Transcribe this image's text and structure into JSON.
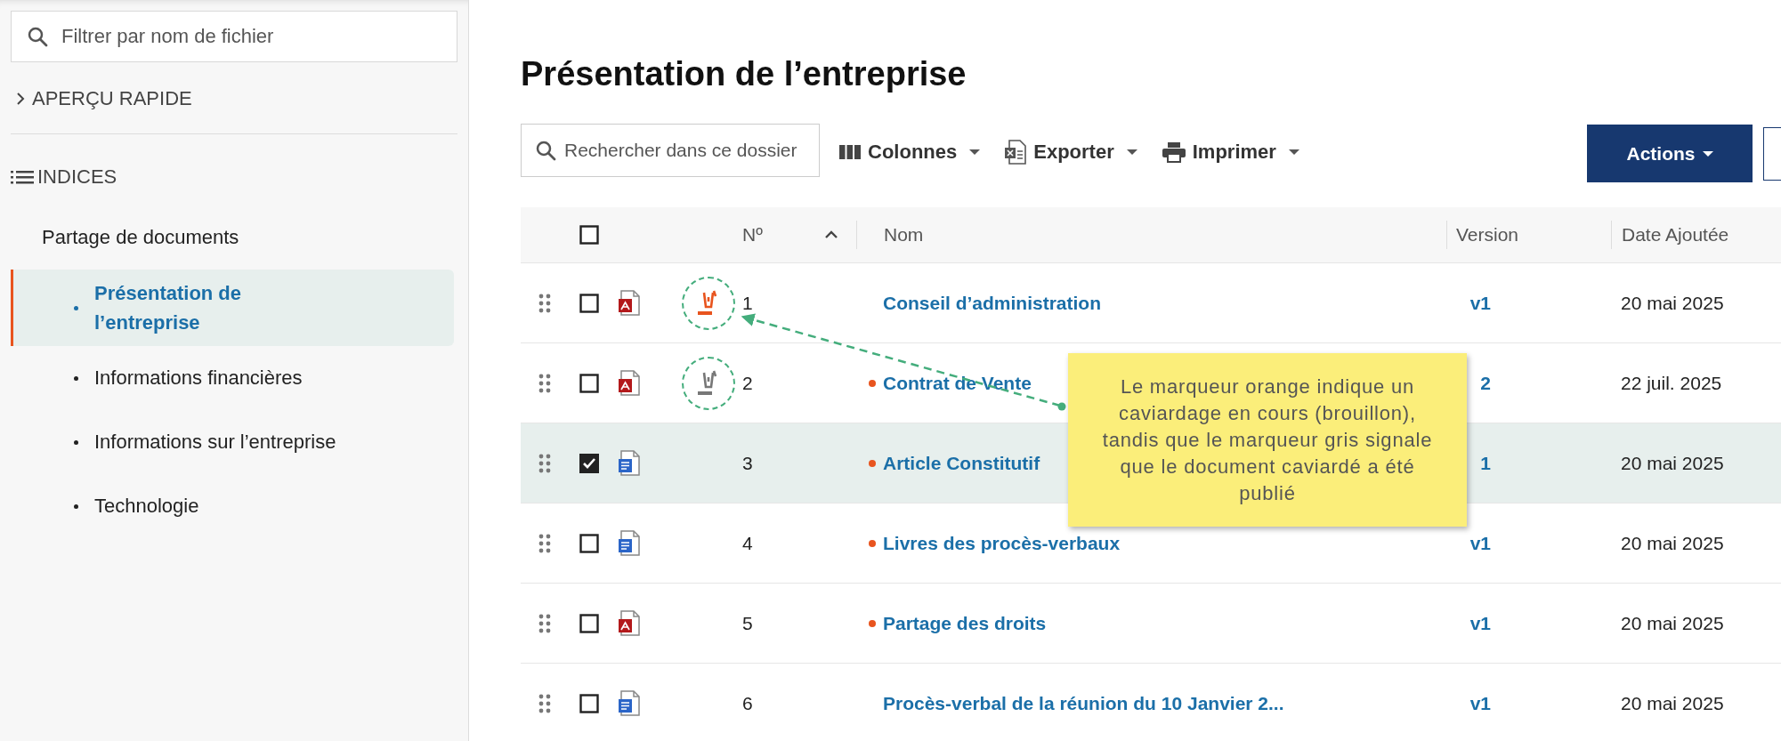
{
  "sidebar": {
    "filter": {
      "placeholder": "Filtrer par nom de fichier"
    },
    "quick_view": {
      "label": "APERÇU RAPIDE",
      "expanded": false
    },
    "index": {
      "label": "INDICES",
      "items": [
        {
          "label": "Partage de documents",
          "children": [
            {
              "label": "Présentation de l’entreprise",
              "selected": true
            },
            {
              "label": "Informations financières",
              "selected": false
            },
            {
              "label": "Informations sur l’entreprise",
              "selected": false
            },
            {
              "label": "Technologie",
              "selected": false
            }
          ]
        }
      ]
    }
  },
  "page": {
    "title": "Présentation de l’entreprise",
    "toolbar": {
      "search": {
        "placeholder": "Rechercher dans ce dossier"
      },
      "menus": [
        {
          "label": "Colonnes",
          "kind": "columns"
        },
        {
          "label": "Exporter",
          "kind": "export"
        },
        {
          "label": "Imprimer",
          "kind": "print"
        }
      ],
      "actions": {
        "label": "Actions"
      }
    },
    "table": {
      "select_all": {
        "checked": false
      },
      "columns": [
        {
          "label": "Nº",
          "sorted": true
        },
        {
          "label": "Nom"
        },
        {
          "label": "Version"
        },
        {
          "label": "Date Ajoutée"
        }
      ],
      "rows": [
        {
          "kind": "pdf",
          "marker": {
            "kind": "draft"
          },
          "number": "1",
          "dot": false,
          "name": "Conseil d’administration",
          "version": "v1",
          "date": "20 mai 2025",
          "checked": false
        },
        {
          "kind": "pdf",
          "marker": {
            "kind": "published"
          },
          "number": "2",
          "dot": true,
          "name": "Contrat de Vente",
          "version": "2",
          "date": "22 juil. 2025",
          "checked": false
        },
        {
          "kind": "word",
          "number": "3",
          "dot": true,
          "name": "Article Constitutif",
          "version": "1",
          "date": "20 mai 2025",
          "checked": true
        },
        {
          "kind": "word",
          "number": "4",
          "dot": true,
          "name": "Livres des procès-verbaux",
          "version": "v1",
          "date": "20 mai 2025",
          "checked": false
        },
        {
          "kind": "pdf",
          "number": "5",
          "dot": true,
          "name": "Partage des droits",
          "version": "v1",
          "date": "20 mai 2025",
          "checked": false
        },
        {
          "kind": "word",
          "number": "6",
          "dot": false,
          "name": "Procès-verbal de la réunion du 10 Janvier 2...",
          "version": "v1",
          "date": "20 mai 2025",
          "checked": false
        }
      ]
    }
  },
  "callout": {
    "text": "Le marqueur orange indique un caviardage en cours (brouillon), tandis que le marqueur gris signale que le document caviardé a été publié"
  }
}
